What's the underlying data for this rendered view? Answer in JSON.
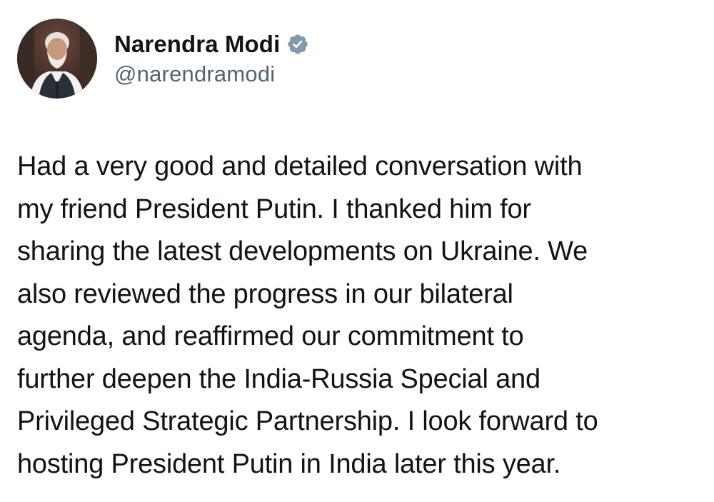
{
  "author": {
    "display_name": "Narendra Modi",
    "handle": "@narendramodi",
    "avatar": "profile-photo",
    "verified_icon": "verified-badge-icon"
  },
  "post": {
    "text": "Had a very good and detailed conversation with\nmy friend President Putin. I thanked him for\nsharing the latest developments on Ukraine. We\nalso reviewed the progress in our bilateral\nagenda, and reaffirmed our commitment to\nfurther deepen the India-Russia Special and\nPrivileged Strategic Partnership. I look forward to\nhosting President Putin in India later this year."
  },
  "colors": {
    "text": "#0f1419",
    "handle": "#536471",
    "verified_badge": "#829aab",
    "background": "#ffffff"
  }
}
